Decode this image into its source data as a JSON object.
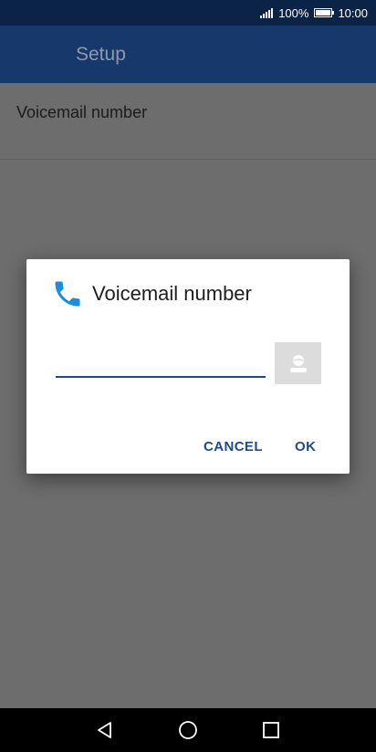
{
  "status_bar": {
    "battery_percent": "100%",
    "time": "10:00"
  },
  "app_bar": {
    "title": "Setup"
  },
  "list": {
    "items": [
      {
        "label": "Voicemail number"
      }
    ]
  },
  "dialog": {
    "title": "Voicemail number",
    "input_value": "",
    "cancel_label": "CANCEL",
    "ok_label": "OK"
  },
  "colors": {
    "accent": "#1e4b8c",
    "phone_icon": "#1a8fe0",
    "app_bar": "#17386a",
    "status_bar": "#0b2346"
  },
  "icons": {
    "signal": "signal-icon",
    "battery": "battery-icon",
    "phone": "phone-icon",
    "contact": "contact-icon",
    "back": "back-icon",
    "home": "home-icon",
    "recents": "recents-icon"
  }
}
